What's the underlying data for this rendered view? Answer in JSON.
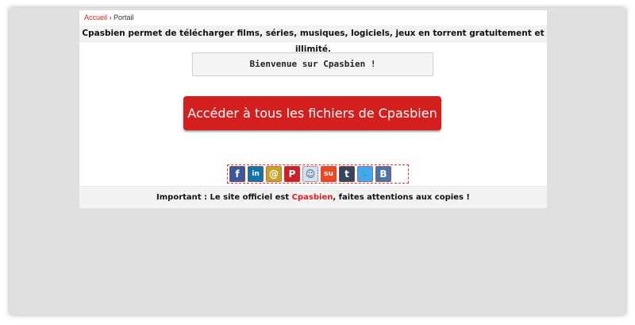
{
  "breadcrumb": {
    "home": "Accueil",
    "separator": "›",
    "current": "Portail"
  },
  "tagline": "Cpasbien permet de télécharger films, séries, musiques, logiciels, jeux en torrent gratuitement et illimité.",
  "welcome": "Bienvenue sur Cpasbien !",
  "cta_label": "Accéder à tous les fichiers de Cpasbien",
  "share": [
    {
      "icon": "facebook-icon",
      "glyph": "f",
      "color": "#3b5998"
    },
    {
      "icon": "linkedin-icon",
      "glyph": "in",
      "color": "#0e76a8"
    },
    {
      "icon": "email-icon",
      "glyph": "@",
      "color": "#c9a227"
    },
    {
      "icon": "pinterest-icon",
      "glyph": "P",
      "color": "#cb2027"
    },
    {
      "icon": "reddit-icon",
      "glyph": "☺",
      "color": "#cfe3f5"
    },
    {
      "icon": "stumbleupon-icon",
      "glyph": "su",
      "color": "#eb4924"
    },
    {
      "icon": "tumblr-icon",
      "glyph": "t",
      "color": "#35465c"
    },
    {
      "icon": "twitter-icon",
      "glyph": "🐦",
      "color": "#3fa9f5"
    },
    {
      "icon": "vk-icon",
      "glyph": "B",
      "color": "#4c75a3"
    }
  ],
  "footer": {
    "prefix": "Important : Le site officiel est ",
    "brand": "Cpasbien",
    "suffix": ", faites attentions aux copies !"
  },
  "colors": {
    "accent": "#d41f1f",
    "link": "#cc2020",
    "viewport_bg": "#e0e0e0"
  }
}
